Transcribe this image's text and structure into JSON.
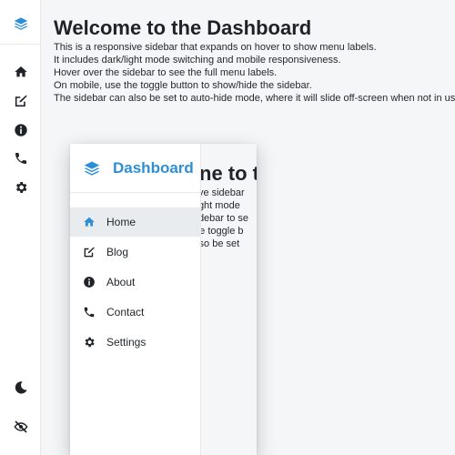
{
  "colors": {
    "accent": "#2f8fd6",
    "icon": "#1f2328",
    "active_bg": "#e9ecef"
  },
  "rail": {
    "logo_icon": "layers-icon",
    "items": [
      {
        "icon": "home-icon"
      },
      {
        "icon": "edit-icon"
      },
      {
        "icon": "info-icon"
      },
      {
        "icon": "phone-icon"
      },
      {
        "icon": "gear-icon"
      }
    ],
    "bottom": [
      {
        "icon": "moon-icon"
      },
      {
        "icon": "eye-slash-icon"
      }
    ]
  },
  "main": {
    "title": "Welcome to the Dashboard",
    "lines": [
      "This is a responsive sidebar that expands on hover to show menu labels.",
      "It includes dark/light mode switching and mobile responsiveness.",
      "Hover over the sidebar to see the full menu labels.",
      "On mobile, use the toggle button to show/hide the sidebar.",
      "The sidebar can also be set to auto-hide mode, where it will slide off-screen when not in use."
    ]
  },
  "preview": {
    "brand": "Dashboard",
    "ghost_title": "ne to t",
    "ghost_lines": [
      "sive sidebar",
      "/light mode",
      "sidebar to se",
      "the toggle b",
      "also be set"
    ],
    "menu": [
      {
        "label": "Home",
        "icon": "home-icon",
        "active": true
      },
      {
        "label": "Blog",
        "icon": "edit-icon",
        "active": false
      },
      {
        "label": "About",
        "icon": "info-icon",
        "active": false
      },
      {
        "label": "Contact",
        "icon": "phone-icon",
        "active": false
      },
      {
        "label": "Settings",
        "icon": "gear-icon",
        "active": false
      }
    ]
  }
}
